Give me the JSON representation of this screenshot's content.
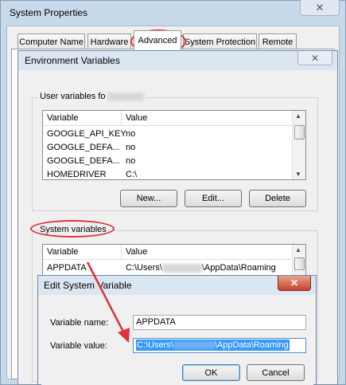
{
  "system_properties": {
    "title": "System Properties",
    "close_glyph": "✕",
    "tabs": [
      {
        "label": "Computer Name",
        "active": false
      },
      {
        "label": "Hardware",
        "active": false
      },
      {
        "label": "Advanced",
        "active": true
      },
      {
        "label": "System Protection",
        "active": false
      },
      {
        "label": "Remote",
        "active": false
      }
    ]
  },
  "env_dialog": {
    "title": "Environment Variables",
    "close_glyph": "✕",
    "user_group_label": "User variables fo",
    "user_table": {
      "columns": [
        "Variable",
        "Value"
      ],
      "rows": [
        {
          "variable": "GOOGLE_API_KEY",
          "value": "no"
        },
        {
          "variable": "GOOGLE_DEFA...",
          "value": "no"
        },
        {
          "variable": "GOOGLE_DEFA...",
          "value": "no"
        },
        {
          "variable": "HOMEDRIVER",
          "value": "C:\\"
        }
      ]
    },
    "buttons": {
      "new": "New...",
      "edit": "Edit...",
      "delete": "Delete"
    },
    "system_group_label": "System variables",
    "system_table": {
      "columns": [
        "Variable",
        "Value"
      ],
      "rows": [
        {
          "variable": "APPDATA",
          "value_prefix": "C:\\Users\\",
          "value_suffix": "\\AppData\\Roaming"
        }
      ]
    }
  },
  "edit_dialog": {
    "title": "Edit System Variable",
    "close_glyph": "✕",
    "name_label": "Variable name:",
    "name_value": "APPDATA",
    "value_label": "Variable value:",
    "value_prefix": "C:\\Users\\",
    "value_suffix": "\\AppData\\Roaming",
    "ok_label": "OK",
    "cancel_label": "Cancel"
  },
  "colors": {
    "annotation": "#e0303a",
    "selection": "#3399ff"
  }
}
